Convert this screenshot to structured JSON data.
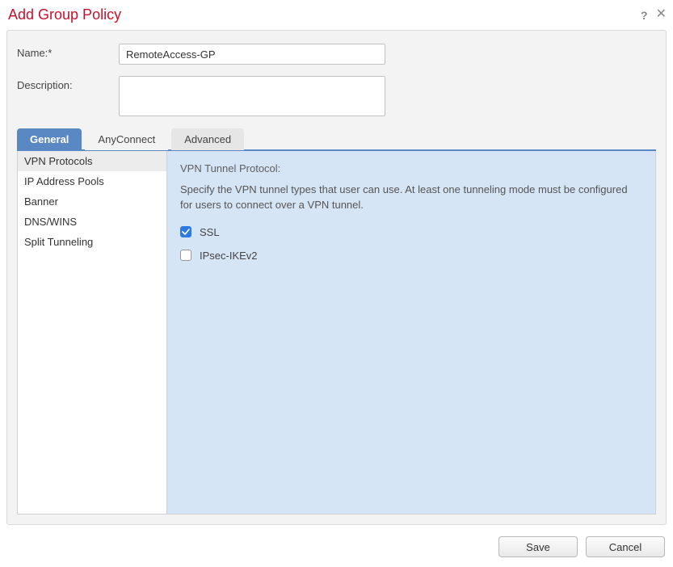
{
  "dialog": {
    "title": "Add Group Policy",
    "form": {
      "name_label": "Name:*",
      "name_value": "RemoteAccess-GP",
      "description_label": "Description:",
      "description_value": ""
    },
    "tabs": [
      {
        "id": "general",
        "label": "General",
        "active": true
      },
      {
        "id": "anyconnect",
        "label": "AnyConnect",
        "active": false
      },
      {
        "id": "advanced",
        "label": "Advanced",
        "active": false
      }
    ],
    "sidenav": [
      {
        "id": "vpn-protocols",
        "label": "VPN Protocols",
        "active": true
      },
      {
        "id": "ip-pools",
        "label": "IP Address Pools",
        "active": false
      },
      {
        "id": "banner",
        "label": "Banner",
        "active": false
      },
      {
        "id": "dns-wins",
        "label": "DNS/WINS",
        "active": false
      },
      {
        "id": "split-tunneling",
        "label": "Split Tunneling",
        "active": false
      }
    ],
    "content": {
      "section_title": "VPN Tunnel Protocol:",
      "section_desc": "Specify the VPN tunnel types that user can use. At least one tunneling mode must be configured for users to connect over a VPN tunnel.",
      "options": [
        {
          "id": "ssl",
          "label": "SSL",
          "checked": true
        },
        {
          "id": "ipsec-ikev2",
          "label": "IPsec-IKEv2",
          "checked": false
        }
      ]
    },
    "footer": {
      "save_label": "Save",
      "cancel_label": "Cancel"
    }
  }
}
